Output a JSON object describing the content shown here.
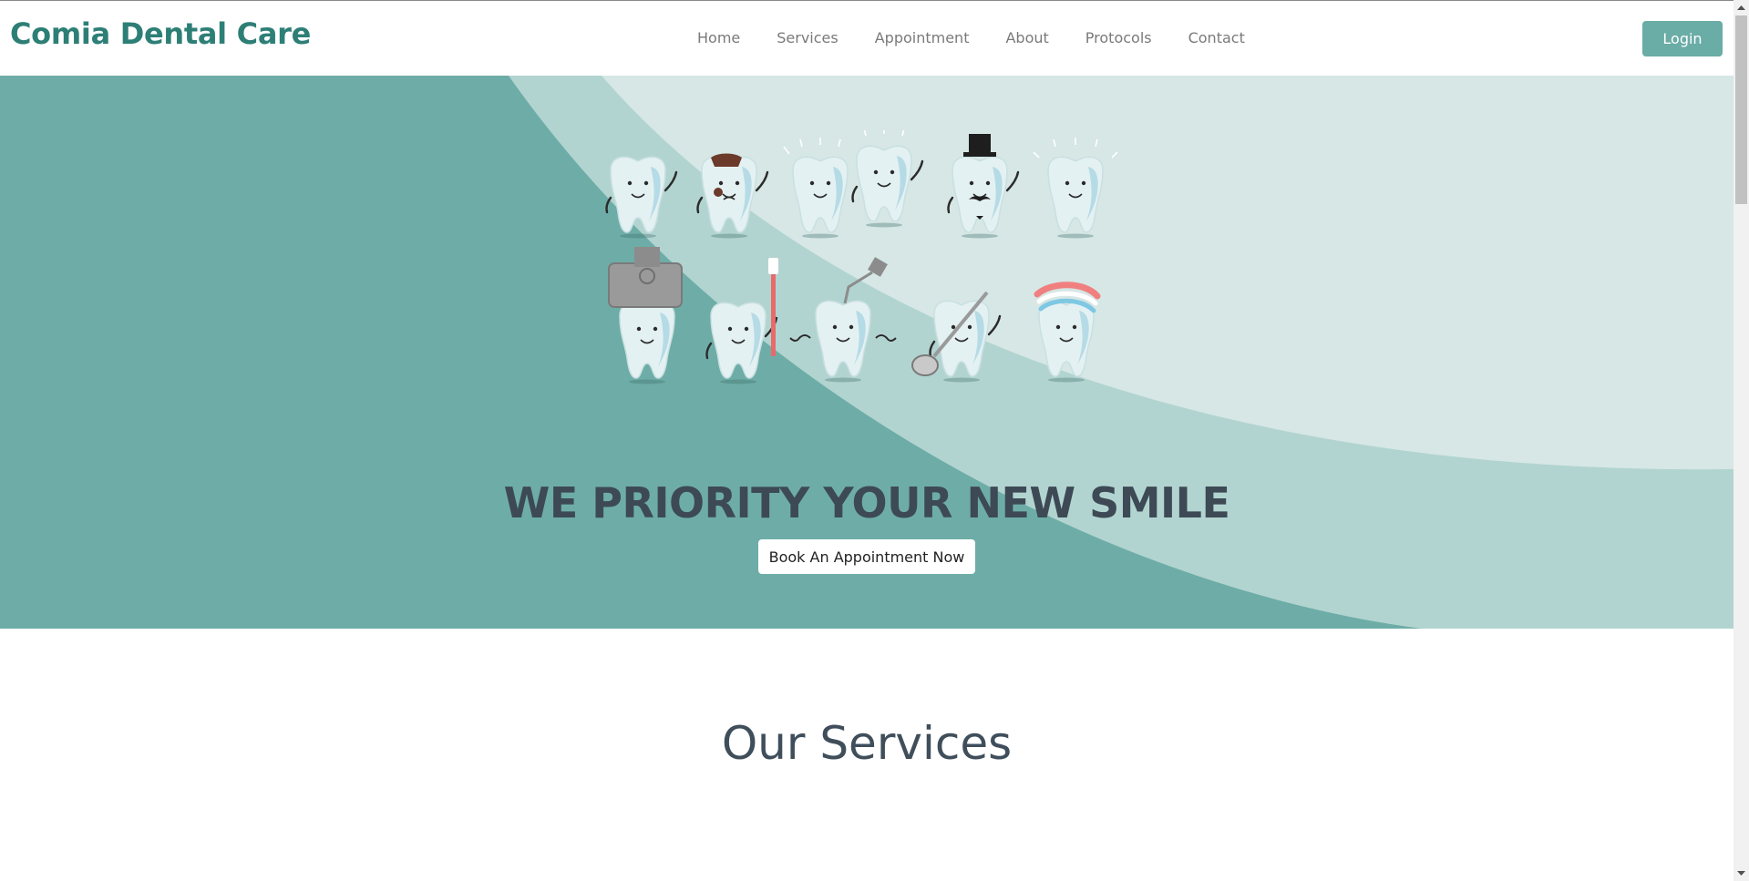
{
  "brand": "Comia Dental Care",
  "nav": {
    "items": [
      {
        "label": "Home"
      },
      {
        "label": "Services"
      },
      {
        "label": "Appointment"
      },
      {
        "label": "About"
      },
      {
        "label": "Protocols"
      },
      {
        "label": "Contact"
      }
    ],
    "login_label": "Login"
  },
  "hero": {
    "title": "WE PRIORITY YOUR NEW SMILE",
    "cta_label": "Book An Appointment Now"
  },
  "services": {
    "title": "Our Services"
  },
  "colors": {
    "brand": "#2d7f76",
    "hero_bg": "#6eada7",
    "hero_curve_mid": "#b2d4d1",
    "hero_curve_light": "#d6e7e5",
    "login_bg": "#6aaca6",
    "heading": "#3d4a55"
  },
  "icons": [
    "tooth-mascot-illustration",
    "scroll-up-arrow-icon",
    "scroll-down-arrow-icon"
  ]
}
